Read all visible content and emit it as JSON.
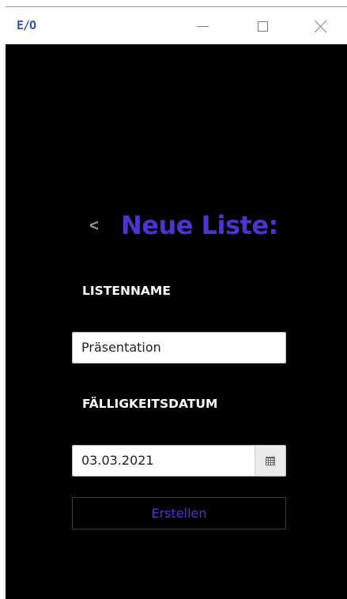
{
  "window": {
    "app_logo_text": "E/O",
    "controls": [
      "minimize",
      "maximize",
      "close"
    ]
  },
  "page": {
    "back_label": "<",
    "title": "Neue Liste:"
  },
  "form": {
    "name_label": "LISTENNAME",
    "name_value": "Präsentation",
    "date_label": "FÄLLIGKEITSDATUM",
    "date_value": "03.03.2021",
    "date_button_icon": "calendar-icon",
    "submit_label": "Erstellen"
  },
  "colors": {
    "background": "#000000",
    "accent": "#4b35d1",
    "label": "#ffffff"
  }
}
